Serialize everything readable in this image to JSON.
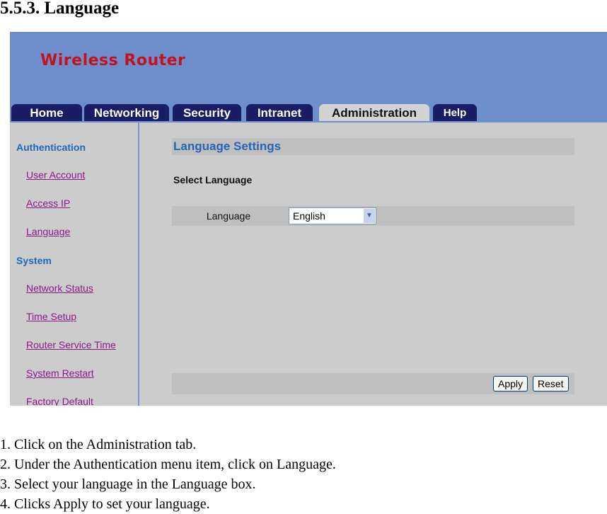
{
  "document": {
    "heading": "5.5.3. Language",
    "steps": [
      "1. Click on the Administration tab.",
      "2. Under the Authentication menu item, click on Language.",
      "3. Select your language in the Language box.",
      "4. Clicks Apply to set your language."
    ]
  },
  "router": {
    "brand": "Wireless Router",
    "colors": {
      "banner": "#6f8ecc",
      "brand": "#c0141c",
      "tab": "#171e66",
      "tab_active": "#d3d3d3",
      "heading_blue": "#2367b5",
      "link": "#8b1a84",
      "panel": "#cccccc"
    },
    "tabs": [
      {
        "label": "Home",
        "active": false
      },
      {
        "label": "Networking",
        "active": false
      },
      {
        "label": "Security",
        "active": false
      },
      {
        "label": "Intranet",
        "active": false
      },
      {
        "label": "Administration",
        "active": true
      },
      {
        "label": "Help",
        "active": false
      }
    ],
    "sidebar": {
      "sections": [
        {
          "title": "Authentication",
          "items": [
            "User Account",
            "Access IP",
            "Language"
          ]
        },
        {
          "title": "System",
          "items": [
            "Network Status",
            "Time Setup",
            "Router Service Time",
            "System Restart",
            "Factory Default"
          ]
        }
      ]
    },
    "main": {
      "title": "Language Settings",
      "subheading": "Select Language",
      "field_label": "Language",
      "selected_language": "English",
      "dropdown_icon": "chevron-down-icon",
      "apply_label": "Apply",
      "reset_label": "Reset"
    }
  }
}
